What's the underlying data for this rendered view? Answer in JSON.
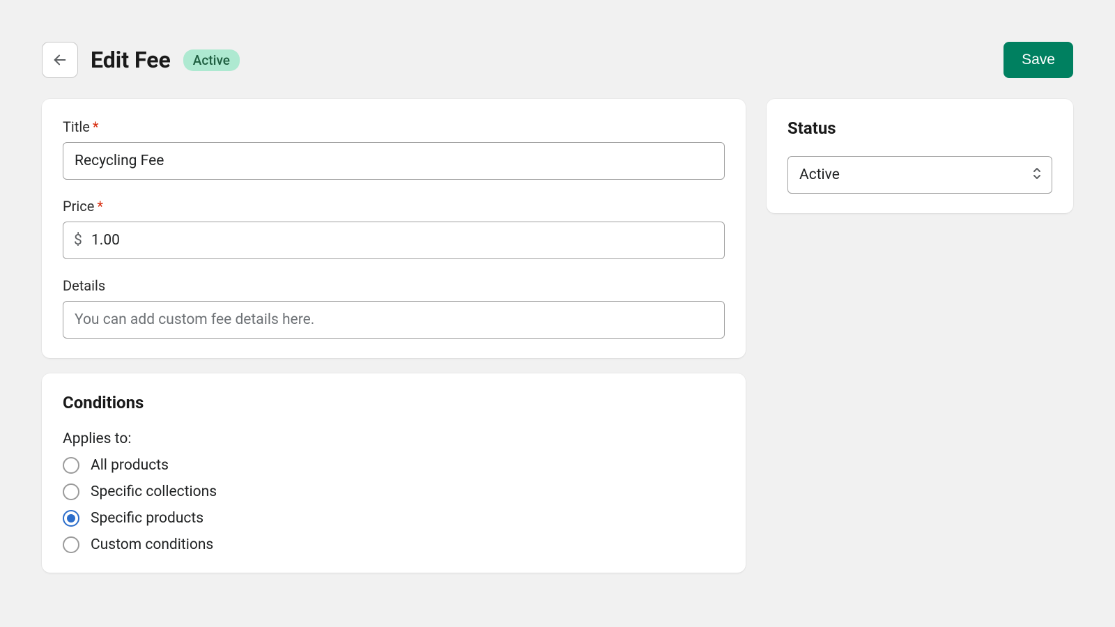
{
  "header": {
    "title": "Edit Fee",
    "badge": "Active",
    "save_label": "Save"
  },
  "form": {
    "title_label": "Title",
    "title_value": "Recycling Fee",
    "price_label": "Price",
    "price_currency": "$",
    "price_value": "1.00",
    "details_label": "Details",
    "details_placeholder": "You can add custom fee details here.",
    "details_value": ""
  },
  "conditions": {
    "heading": "Conditions",
    "applies_label": "Applies to:",
    "options": [
      {
        "label": "All products",
        "selected": false
      },
      {
        "label": "Specific collections",
        "selected": false
      },
      {
        "label": "Specific products",
        "selected": true
      },
      {
        "label": "Custom conditions",
        "selected": false
      }
    ]
  },
  "status": {
    "heading": "Status",
    "value": "Active"
  }
}
